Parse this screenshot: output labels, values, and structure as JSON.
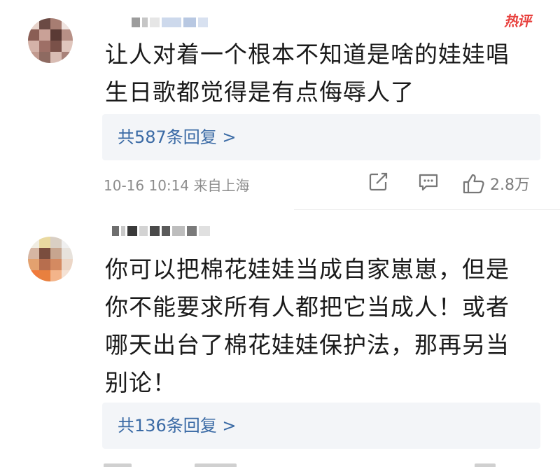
{
  "comments": [
    {
      "hot_badge": "热评",
      "text_lines": [
        "让人对着一个根本不知道是啥的娃娃唱",
        "生日歌都觉得是有点侮辱人了"
      ],
      "replies_label": "共587条回复 >",
      "timestamp": "10-16 10:14",
      "location": "来自上海",
      "like_count": "2.8万"
    },
    {
      "text_lines": [
        "你可以把棉花娃娃当成自家崽崽，但是",
        "你不能要求所有人都把它当成人！或者",
        "哪天出台了棉花娃娃保护法，那再另当",
        "别论！"
      ],
      "replies_label": "共136条回复 >"
    }
  ],
  "colors": {
    "text": "#1a1a1a",
    "link": "#3a6aa5",
    "meta": "#8c8c8c",
    "hot": "#e8413e",
    "reply_bg": "#f3f5f8"
  },
  "icons": [
    "share-icon",
    "comment-icon",
    "like-icon"
  ]
}
